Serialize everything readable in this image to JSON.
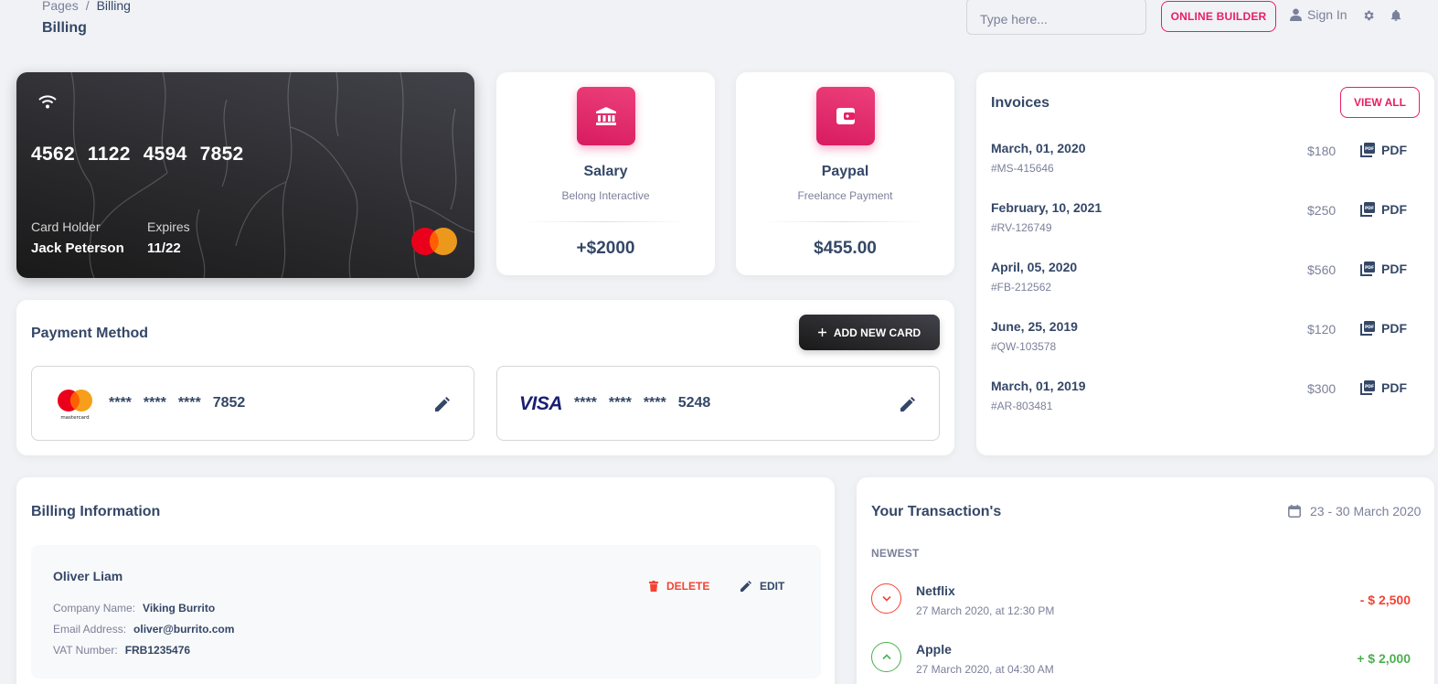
{
  "breadcrumb": {
    "root": "Pages",
    "separator": "/",
    "current": "Billing"
  },
  "page_title": "Billing",
  "header": {
    "search_placeholder": "Type here...",
    "online_builder": "ONLINE BUILDER",
    "sign_in": "Sign In"
  },
  "credit_card": {
    "number": [
      "4562",
      "1122",
      "4594",
      "7852"
    ],
    "holder_label": "Card Holder",
    "holder_name": "Jack Peterson",
    "expires_label": "Expires",
    "expires_value": "11/22"
  },
  "salary": {
    "title": "Salary",
    "subtitle": "Belong Interactive",
    "value": "+$2000",
    "icon": "bank-icon"
  },
  "paypal": {
    "title": "Paypal",
    "subtitle": "Freelance Payment",
    "value": "$455.00",
    "icon": "wallet-icon"
  },
  "invoices": {
    "title": "Invoices",
    "view_all": "VIEW ALL",
    "pdf_label": "PDF",
    "items": [
      {
        "date": "March, 01, 2020",
        "id": "#MS-415646",
        "amount": "$180"
      },
      {
        "date": "February, 10, 2021",
        "id": "#RV-126749",
        "amount": "$250"
      },
      {
        "date": "April, 05, 2020",
        "id": "#FB-212562",
        "amount": "$560"
      },
      {
        "date": "June, 25, 2019",
        "id": "#QW-103578",
        "amount": "$120"
      },
      {
        "date": "March, 01, 2019",
        "id": "#AR-803481",
        "amount": "$300"
      }
    ]
  },
  "payment_method": {
    "title": "Payment Method",
    "add_new_card": "ADD NEW CARD",
    "cards": [
      {
        "brand": "mastercard",
        "mask": [
          "****",
          "****",
          "****"
        ],
        "last4": "7852"
      },
      {
        "brand": "VISA",
        "mask": [
          "****",
          "****",
          "****"
        ],
        "last4": "5248"
      }
    ]
  },
  "billing_info": {
    "title": "Billing Information",
    "name": "Oliver Liam",
    "company_label": "Company Name:",
    "company_value": "Viking Burrito",
    "email_label": "Email Address:",
    "email_value": "oliver@burrito.com",
    "vat_label": "VAT Number:",
    "vat_value": "FRB1235476",
    "delete_label": "DELETE",
    "edit_label": "EDIT"
  },
  "transactions": {
    "title": "Your Transaction's",
    "date_range": "23 - 30 March 2020",
    "group_label": "NEWEST",
    "items": [
      {
        "name": "Netflix",
        "date": "27 March 2020, at 12:30 PM",
        "amount": "- $ 2,500",
        "direction": "down"
      },
      {
        "name": "Apple",
        "date": "27 March 2020, at 04:30 AM",
        "amount": "+ $ 2,000",
        "direction": "up"
      }
    ]
  },
  "colors": {
    "accent": "#e91e63",
    "text": "#344767",
    "muted": "#7b809a",
    "danger": "#f44335",
    "success": "#4caf50"
  }
}
